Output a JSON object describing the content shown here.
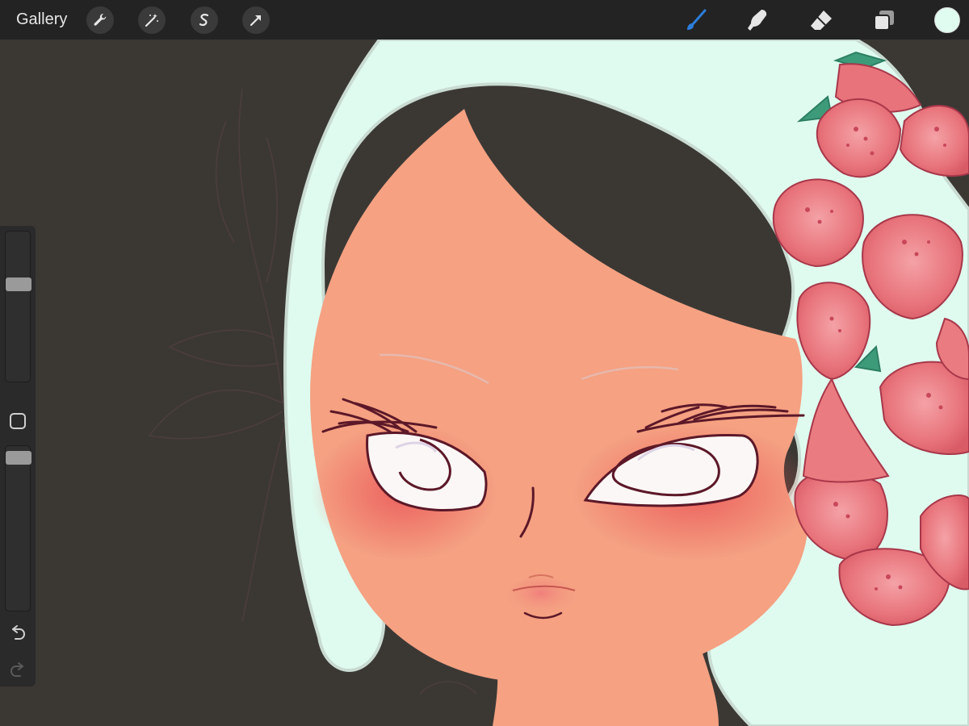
{
  "toolbar": {
    "gallery_label": "Gallery",
    "left_tools": [
      {
        "name": "actions",
        "icon": "wrench-icon"
      },
      {
        "name": "adjustments",
        "icon": "magic-wand-icon"
      },
      {
        "name": "selection",
        "icon": "selection-s-icon"
      },
      {
        "name": "transform",
        "icon": "arrow-cursor-icon"
      }
    ],
    "right_tools": [
      {
        "name": "brush",
        "icon": "brush-icon",
        "active": true
      },
      {
        "name": "smudge",
        "icon": "smudge-finger-icon",
        "active": false
      },
      {
        "name": "eraser",
        "icon": "eraser-icon",
        "active": false
      },
      {
        "name": "layers",
        "icon": "layers-icon",
        "active": false
      }
    ],
    "current_color": "#e0fbf0",
    "active_color": "#2c7ddb"
  },
  "sidebar": {
    "brush_size": 0.66,
    "brush_opacity": 0.97,
    "modify_icon": "square-outline-icon",
    "undo_icon": "undo-icon",
    "redo_icon": "redo-icon"
  },
  "palette": {
    "background": "#3b3834",
    "hair": "#dffbef",
    "skin": "#f5a182",
    "blush": "#ec6262",
    "eye_white": "#fbf7f6",
    "line": "#5c1828",
    "flower": "#ec7d82"
  }
}
